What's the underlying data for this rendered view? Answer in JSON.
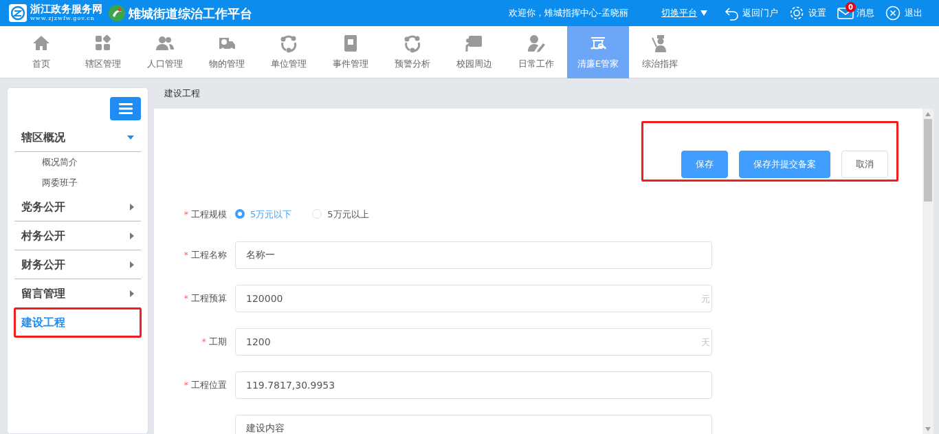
{
  "header": {
    "gov_title": "浙江政务服务网",
    "gov_url": "www.zjzwfw.gov.cn",
    "platform_title": "雉城街道综治工作平台",
    "welcome": "欢迎你，雉城指挥中心-孟晓丽",
    "switch_label": "切换平台",
    "links": [
      {
        "kind": "back",
        "label": "返回门户"
      },
      {
        "kind": "settings",
        "label": "设置"
      },
      {
        "kind": "message",
        "label": "消息",
        "badge": "0"
      },
      {
        "kind": "logout",
        "label": "退出"
      }
    ]
  },
  "nav": {
    "items": [
      {
        "kind": "home",
        "label": "首页",
        "selected": false
      },
      {
        "kind": "grid",
        "label": "辖区管理",
        "selected": false
      },
      {
        "kind": "people",
        "label": "人口管理",
        "selected": false
      },
      {
        "kind": "truck",
        "label": "物的管理",
        "selected": false
      },
      {
        "kind": "network",
        "label": "单位管理",
        "selected": false
      },
      {
        "kind": "book",
        "label": "事件管理",
        "selected": false
      },
      {
        "kind": "network",
        "label": "预警分析",
        "selected": false
      },
      {
        "kind": "board",
        "label": "校园周边",
        "selected": false
      },
      {
        "kind": "writer",
        "label": "日常工作",
        "selected": false
      },
      {
        "kind": "pavilion",
        "label": "清廉E管家",
        "selected": true
      },
      {
        "kind": "officer",
        "label": "综治指挥",
        "selected": false
      }
    ]
  },
  "sidebar": {
    "items": [
      {
        "label": "辖区概况",
        "expanded": true,
        "selected": false,
        "highlighted": false,
        "children": [
          {
            "label": "概况简介"
          },
          {
            "label": "两委班子"
          }
        ]
      },
      {
        "label": "党务公开",
        "expanded": false,
        "selected": false,
        "highlighted": false
      },
      {
        "label": "村务公开",
        "expanded": false,
        "selected": false,
        "highlighted": false
      },
      {
        "label": "财务公开",
        "expanded": false,
        "selected": false,
        "highlighted": false
      },
      {
        "label": "留言管理",
        "expanded": false,
        "selected": false,
        "highlighted": false
      },
      {
        "label": "建设工程",
        "selected": true,
        "highlighted": true
      }
    ]
  },
  "breadcrumb": "建设工程",
  "actions": {
    "highlighted": true,
    "buttons": [
      {
        "kind": "primary",
        "label": "保存"
      },
      {
        "kind": "primary",
        "label": "保存并提交备案"
      },
      {
        "kind": "default",
        "label": "取消"
      }
    ]
  },
  "form": {
    "fields": [
      {
        "kind": "radio",
        "label": "工程规模",
        "required_mark": "*",
        "options": [
          {
            "label": "5万元以下",
            "selected": true
          },
          {
            "label": "5万元以上",
            "selected": false
          }
        ]
      },
      {
        "kind": "input",
        "label": "工程名称",
        "required_mark": "*",
        "value": "名称一"
      },
      {
        "kind": "input",
        "label": "工程预算",
        "required_mark": "*",
        "value": "120000",
        "suffix": "元"
      },
      {
        "kind": "input",
        "label": "工期",
        "required_mark": "*",
        "value": "1200",
        "suffix": "天"
      },
      {
        "kind": "input",
        "label": "工程位置",
        "required_mark": "*",
        "value": "119.7817,30.9953"
      },
      {
        "kind": "input",
        "value": "建设内容"
      }
    ]
  }
}
